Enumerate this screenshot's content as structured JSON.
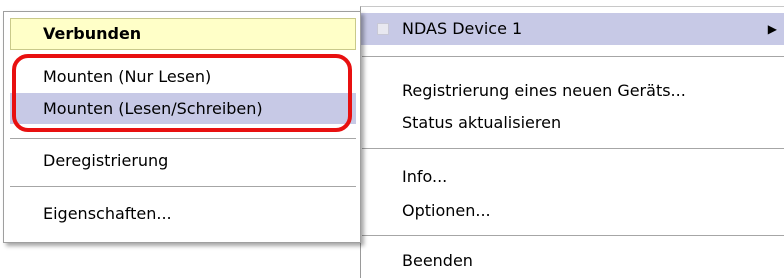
{
  "main_menu": {
    "device_item": {
      "label": "NDAS Device 1",
      "icon": "square-icon",
      "submenu_icon": "arrow-right-icon"
    },
    "register_new_label": "Registrierung eines neuen Geräts...",
    "refresh_status_label": "Status aktualisieren",
    "info_label": "Info...",
    "options_label": "Optionen...",
    "exit_label": "Beenden"
  },
  "sub_menu": {
    "header_label": "Verbunden",
    "mount_readonly_label": "Mounten (Nur Lesen)",
    "mount_readwrite_label": "Mounten (Lesen/Schreiben)",
    "unregister_label": "Deregistrierung",
    "properties_label": "Eigenschaften..."
  },
  "colors": {
    "highlight": "#c7c9e6",
    "header_background": "#ffffc8",
    "annotation": "#e81010"
  }
}
